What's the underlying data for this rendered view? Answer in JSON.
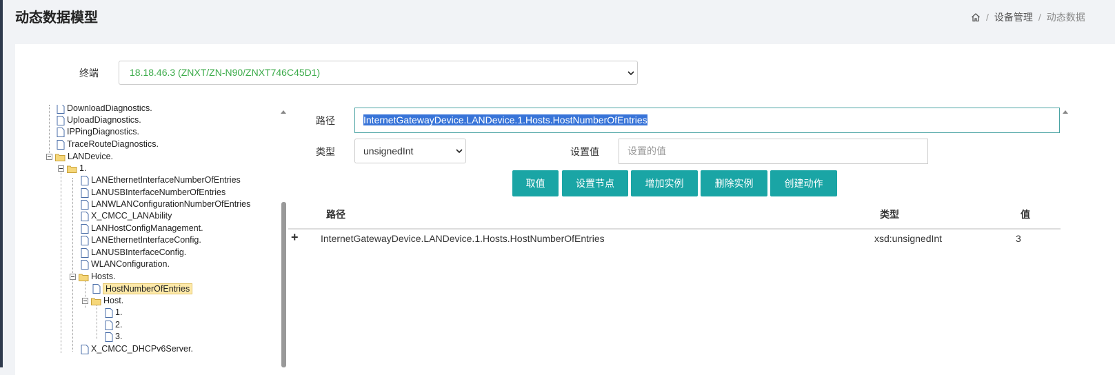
{
  "page": {
    "title": "动态数据模型"
  },
  "breadcrumb": {
    "item1": "设备管理",
    "item2": "动态数据",
    "sep": "/"
  },
  "terminal": {
    "label": "终端",
    "value": "18.18.46.3 (ZNXT/ZN-N90/ZNXT746C45D1)"
  },
  "tree": {
    "items": [
      {
        "label": "DownloadDiagnostics."
      },
      {
        "label": "UploadDiagnostics."
      },
      {
        "label": "IPPingDiagnostics."
      },
      {
        "label": "TraceRouteDiagnostics."
      },
      {
        "label": "LANDevice."
      },
      {
        "label": "1."
      },
      {
        "label": "LANEthernetInterfaceNumberOfEntries"
      },
      {
        "label": "LANUSBInterfaceNumberOfEntries"
      },
      {
        "label": "LANWLANConfigurationNumberOfEntries"
      },
      {
        "label": "X_CMCC_LANAbility"
      },
      {
        "label": "LANHostConfigManagement."
      },
      {
        "label": "LANEthernetInterfaceConfig."
      },
      {
        "label": "LANUSBInterfaceConfig."
      },
      {
        "label": "WLANConfiguration."
      },
      {
        "label": "Hosts."
      },
      {
        "label": "HostNumberOfEntries"
      },
      {
        "label": "Host."
      },
      {
        "label": "1."
      },
      {
        "label": "2."
      },
      {
        "label": "3."
      },
      {
        "label": "X_CMCC_DHCPv6Server."
      }
    ]
  },
  "form": {
    "path_label": "路径",
    "path_value": "InternetGatewayDevice.LANDevice.1.Hosts.HostNumberOfEntries",
    "type_label": "类型",
    "type_value": "unsignedInt",
    "set_value_label": "设置值",
    "set_value_placeholder": "设置的值"
  },
  "buttons": {
    "get": "取值",
    "set": "设置节点",
    "add": "增加实例",
    "delete": "删除实例",
    "create": "创建动作"
  },
  "table": {
    "headers": {
      "path": "路径",
      "type": "类型",
      "value": "值"
    },
    "rows": [
      {
        "expand": "+",
        "path": "InternetGatewayDevice.LANDevice.1.Hosts.HostNumberOfEntries",
        "type": "xsd:unsignedInt",
        "value": "3"
      }
    ]
  }
}
